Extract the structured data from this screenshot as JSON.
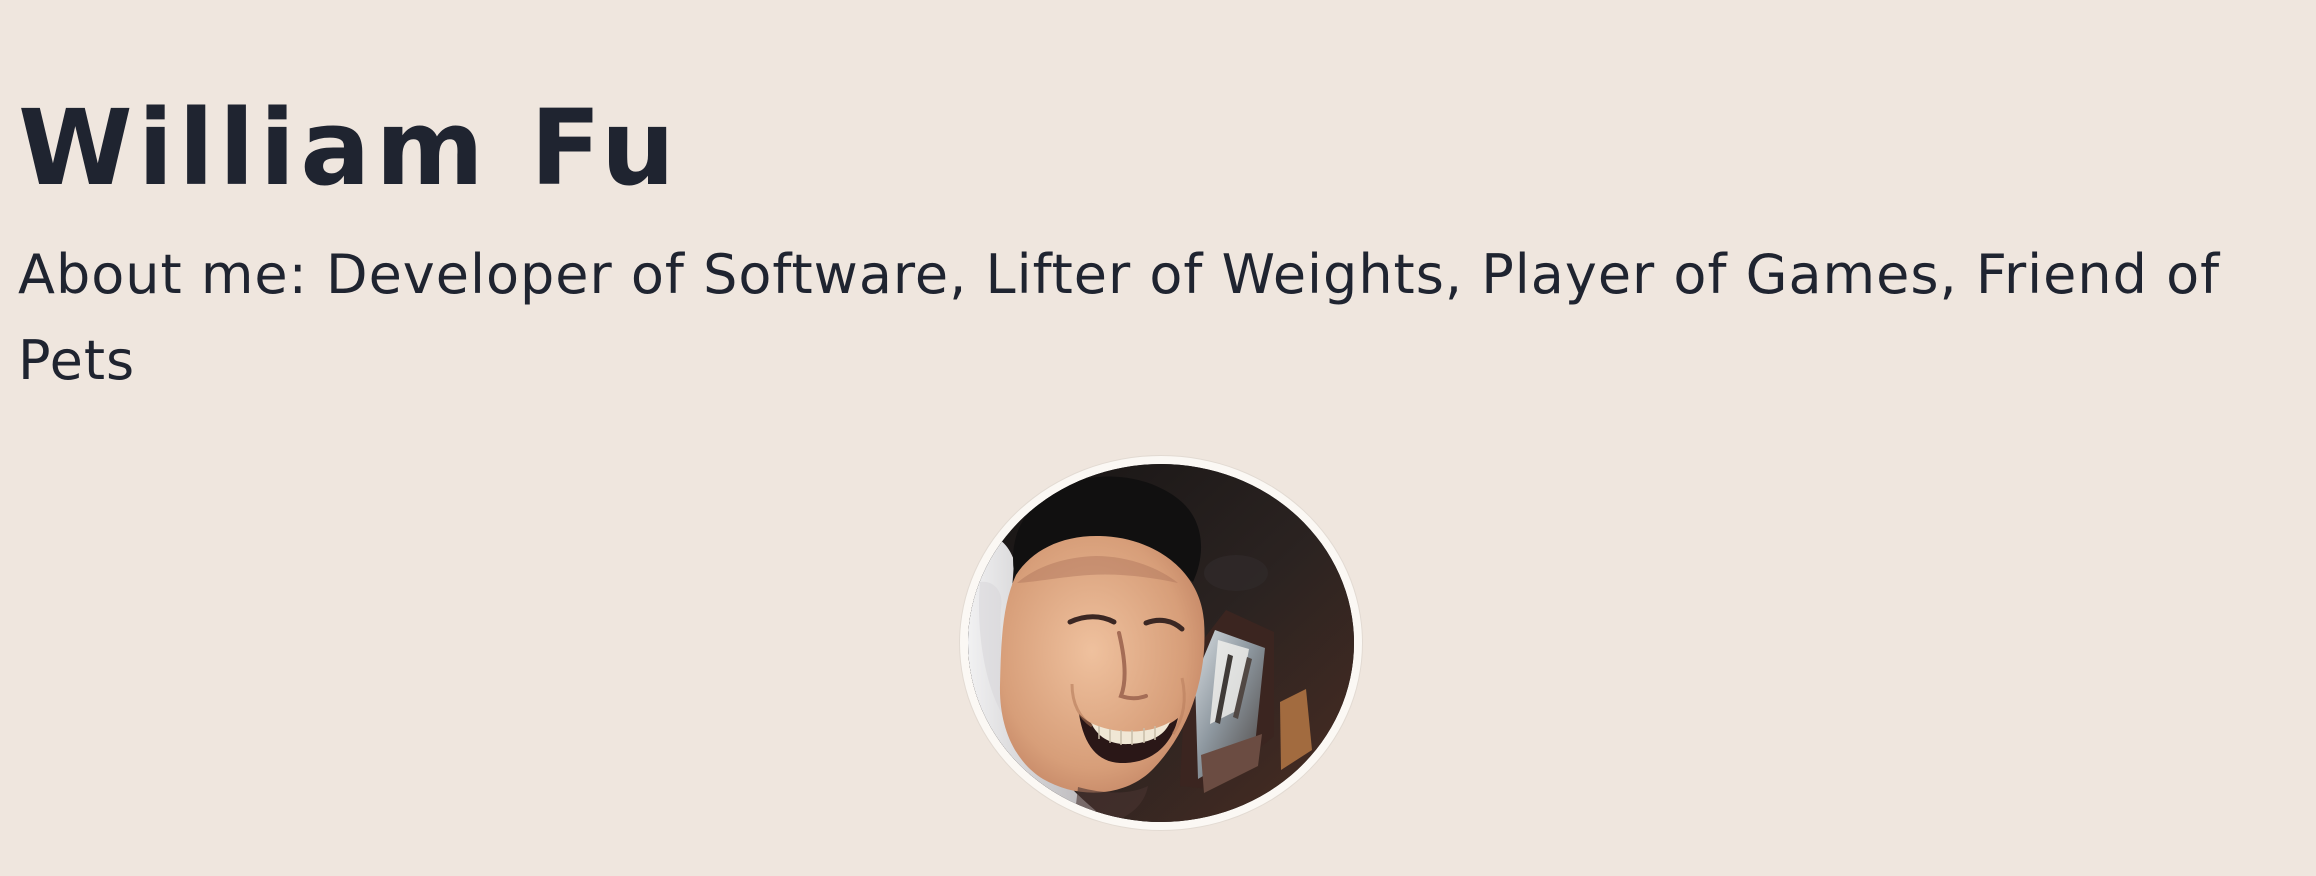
{
  "profile": {
    "name": "William Fu",
    "about": "About me: Developer of Software, Lifter of Weights, Player of Games, Friend of Pets"
  },
  "avatar": {
    "icon": "profile-photo"
  },
  "colors": {
    "background": "#efe6de",
    "text": "#1f2430",
    "avatar_border": "#fbf8f4"
  }
}
